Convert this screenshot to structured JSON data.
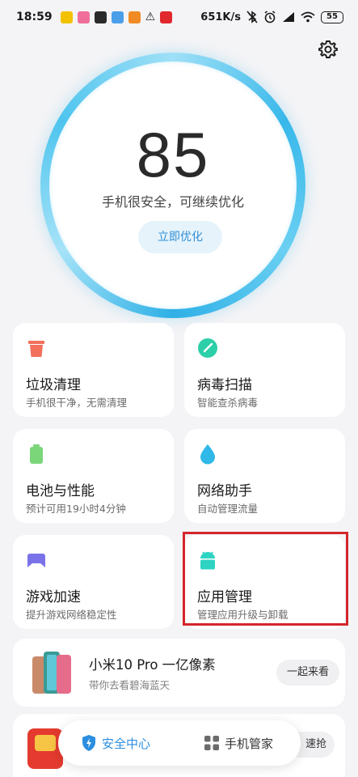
{
  "status_bar": {
    "time": "18:59",
    "network_speed": "651K/s",
    "battery": "55",
    "notification_icons": [
      {
        "name": "app-notification-icon",
        "color": "#f2c200"
      },
      {
        "name": "app-notification-icon",
        "color": "#f06f9a"
      },
      {
        "name": "app-notification-icon",
        "color": "#2a2a2a"
      },
      {
        "name": "app-notification-icon",
        "color": "#4a9fe8"
      },
      {
        "name": "app-notification-icon",
        "color": "#f08a24"
      },
      {
        "name": "warning-icon",
        "color": "#1a1a1a"
      },
      {
        "name": "app-notification-icon",
        "color": "#e0282e"
      }
    ]
  },
  "score": {
    "value": "85",
    "caption": "手机很安全，可继续优化",
    "button_label": "立即优化"
  },
  "cards": [
    {
      "id": "trash",
      "title": "垃圾清理",
      "subtitle": "手机很干净，无需清理",
      "icon": "trash-icon",
      "color": "#f2705c"
    },
    {
      "id": "virus",
      "title": "病毒扫描",
      "subtitle": "智能查杀病毒",
      "icon": "virus-scan-icon",
      "color": "#2ccfa8"
    },
    {
      "id": "battery",
      "title": "电池与性能",
      "subtitle": "预计可用19小时4分钟",
      "icon": "battery-icon",
      "color": "#7bd67a"
    },
    {
      "id": "network",
      "title": "网络助手",
      "subtitle": "自动管理流量",
      "icon": "water-drop-icon",
      "color": "#2fb8e8"
    },
    {
      "id": "game",
      "title": "游戏加速",
      "subtitle": "提升游戏网络稳定性",
      "icon": "gamepad-icon",
      "color": "#7a72e8"
    },
    {
      "id": "app",
      "title": "应用管理",
      "subtitle": "管理应用升级与卸载",
      "icon": "android-icon",
      "color": "#2ed3c2"
    }
  ],
  "promo": {
    "title": "小米10 Pro 一亿像素",
    "subtitle": "带你去看碧海蓝天",
    "button_label": "一起来看"
  },
  "promo2": {
    "button_label": "速抢"
  },
  "bottom_nav": {
    "security_label": "安全中心",
    "manager_label": "手机管家"
  },
  "colors": {
    "accent_blue": "#2c8ee0",
    "highlight_red": "#d4252c",
    "ring_blue": "#38b8ea"
  }
}
